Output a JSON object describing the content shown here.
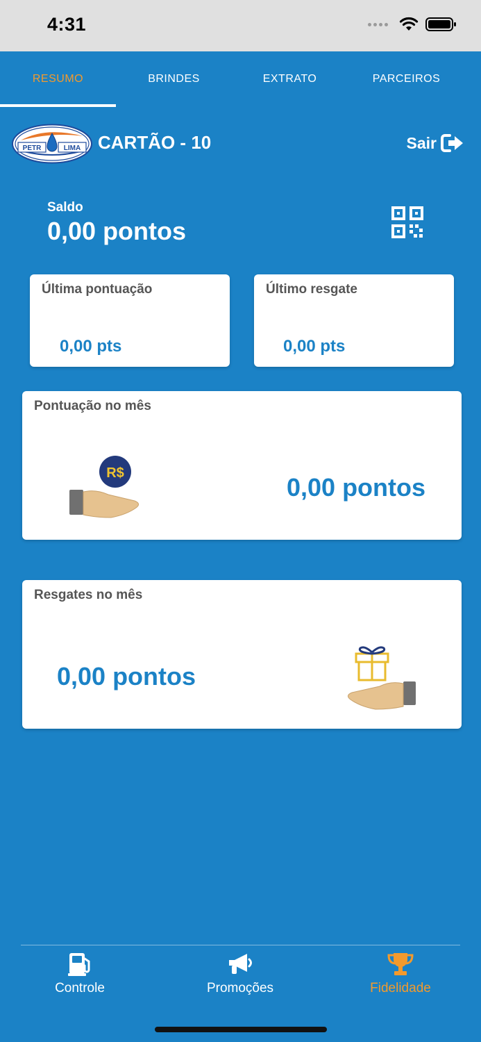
{
  "status_bar": {
    "time": "4:31"
  },
  "tabs": [
    {
      "label": "RESUMO",
      "active": true
    },
    {
      "label": "BRINDES",
      "active": false
    },
    {
      "label": "EXTRATO",
      "active": false
    },
    {
      "label": "PARCEIROS",
      "active": false
    }
  ],
  "header": {
    "logo_text_left": "PETR",
    "logo_text_right": "LIMA",
    "card_title": "CARTÃO - 10",
    "logout_label": "Sair"
  },
  "balance": {
    "label": "Saldo",
    "value": "0,00 pontos"
  },
  "cards": {
    "last_points": {
      "label": "Última pontuação",
      "value": "0,00 pts"
    },
    "last_redeem": {
      "label": "Último resgate",
      "value": "0,00 pts"
    },
    "month_points": {
      "label": "Pontuação no mês",
      "value": "0,00 pontos",
      "coin_text": "R$"
    },
    "month_redeems": {
      "label": "Resgates no mês",
      "value": "0,00 pontos"
    }
  },
  "bottom_nav": [
    {
      "label": "Controle",
      "icon": "fuel-pump-icon",
      "active": false
    },
    {
      "label": "Promoções",
      "icon": "megaphone-icon",
      "active": false
    },
    {
      "label": "Fidelidade",
      "icon": "trophy-icon",
      "active": true
    }
  ],
  "colors": {
    "background": "#1b82c6",
    "accent": "#f39a2c",
    "card": "#ffffff",
    "label_gray": "#555555"
  }
}
